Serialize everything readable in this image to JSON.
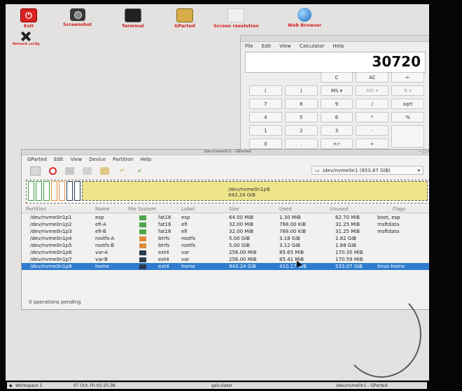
{
  "desktop": {
    "icons": [
      {
        "label": "Exit",
        "icon": "power-icon"
      },
      {
        "label": "Screenshot",
        "icon": "camera-icon"
      },
      {
        "label": "Terminal",
        "icon": "terminal-icon"
      },
      {
        "label": "GParted",
        "icon": "gparted-icon"
      },
      {
        "label": "Screen resolution",
        "icon": "display-icon"
      },
      {
        "label": "Web Browser",
        "icon": "globe-icon"
      },
      {
        "label": "Network config",
        "icon": "tools-icon"
      }
    ]
  },
  "calculator": {
    "menu": [
      "File",
      "Edit",
      "View",
      "Calculator",
      "Help"
    ],
    "display": "30720",
    "keys": [
      [
        "",
        "",
        "C",
        "AC",
        "←"
      ],
      [
        "(",
        ")",
        "MS ▾",
        "MR ▾",
        "R ▾"
      ],
      [
        "7",
        "8",
        "9",
        "/",
        "sqrt"
      ],
      [
        "4",
        "5",
        "6",
        "*",
        "%"
      ],
      [
        "1",
        "2",
        "3",
        "-",
        ""
      ],
      [
        "0",
        ".",
        "+/-",
        "+",
        ""
      ]
    ]
  },
  "gparted": {
    "title": "/dev/nvme0n1 - GParted",
    "menu": [
      "GParted",
      "Edit",
      "View",
      "Device",
      "Partition",
      "Help"
    ],
    "device": "/dev/nvme0n1 (953.87 GiB)",
    "map_label": "/dev/nvme0n1p8",
    "map_size": "943.24 GiB",
    "columns": [
      "Partition",
      "Name",
      "File System",
      "Label",
      "Size",
      "Used",
      "Unused",
      "Flags"
    ],
    "rows": [
      {
        "partition": "/dev/nvme0n1p1",
        "name": "esp",
        "fs": "fat16",
        "label": "esp",
        "size": "64.00 MiB",
        "used": "1.30 MiB",
        "unused": "62.70 MiB",
        "flags": "boot, esp",
        "color": "#4ea64a"
      },
      {
        "partition": "/dev/nvme0n1p2",
        "name": "efi-A",
        "fs": "fat16",
        "label": "efi",
        "size": "32.00 MiB",
        "used": "768.00 KiB",
        "unused": "31.25 MiB",
        "flags": "msftdata",
        "color": "#4ea64a"
      },
      {
        "partition": "/dev/nvme0n1p3",
        "name": "efi-B",
        "fs": "fat16",
        "label": "efi",
        "size": "32.00 MiB",
        "used": "768.00 KiB",
        "unused": "31.25 MiB",
        "flags": "msftdata",
        "color": "#4ea64a"
      },
      {
        "partition": "/dev/nvme0n1p4",
        "name": "rootfs-A",
        "fs": "btrfs",
        "label": "rootfs",
        "size": "5.00 GiB",
        "used": "3.18 GiB",
        "unused": "1.82 GiB",
        "flags": "",
        "color": "#e08a3a"
      },
      {
        "partition": "/dev/nvme0n1p5",
        "name": "rootfs-B",
        "fs": "btrfs",
        "label": "rootfs",
        "size": "5.00 GiB",
        "used": "3.12 GiB",
        "unused": "1.88 GiB",
        "flags": "",
        "color": "#e08a3a"
      },
      {
        "partition": "/dev/nvme0n1p6",
        "name": "var-A",
        "fs": "ext4",
        "label": "var",
        "size": "256.00 MiB",
        "used": "85.65 MiB",
        "unused": "170.35 MiB",
        "flags": "",
        "color": "#2a3a4a"
      },
      {
        "partition": "/dev/nvme0n1p7",
        "name": "var-B",
        "fs": "ext4",
        "label": "var",
        "size": "256.00 MiB",
        "used": "85.41 MiB",
        "unused": "170.59 MiB",
        "flags": "",
        "color": "#2a3a4a"
      },
      {
        "partition": "/dev/nvme0n1p8",
        "name": "home",
        "fs": "ext4",
        "label": "home",
        "size": "943.24 GiB",
        "used": "410.17 GiB",
        "unused": "533.07 GiB",
        "flags": "linux-home",
        "color": "#2a3a4a"
      }
    ],
    "status": "0 operations pending"
  },
  "taskbar": {
    "workspace": "Workspace 1",
    "clock": "07 Oct, Fri 02:25:38",
    "task1": "galculator",
    "task2": "/dev/nvme0n1 - GParted"
  }
}
